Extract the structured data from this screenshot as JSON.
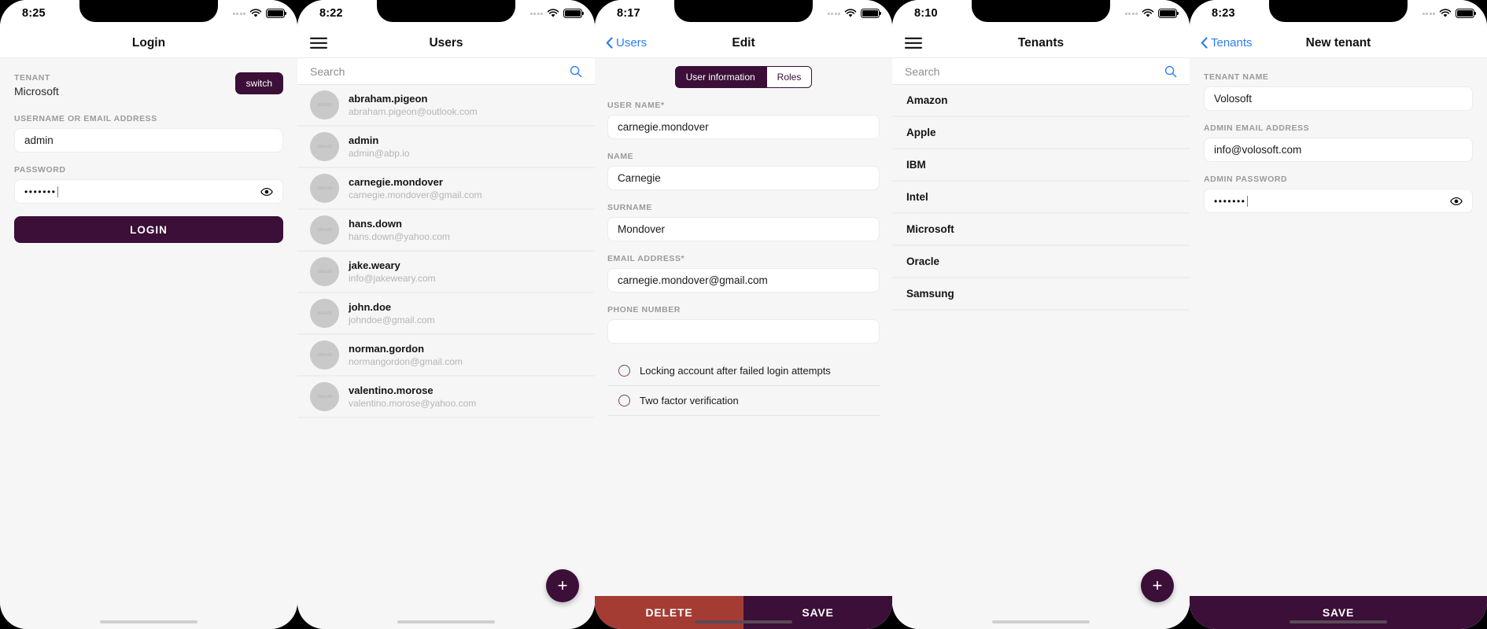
{
  "theme": {
    "primary": "#3b0f38",
    "danger": "#a53c34",
    "link": "#2d7ef7",
    "screen_bg": "#f6f6f6"
  },
  "screens": [
    {
      "id": "login",
      "status": {
        "time": "8:25"
      },
      "nav": {
        "title": "Login"
      },
      "tenant": {
        "label": "TENANT",
        "value": "Microsoft",
        "switch_label": "switch"
      },
      "username": {
        "label": "USERNAME OR EMAIL ADDRESS",
        "value": "admin"
      },
      "password": {
        "label": "PASSWORD",
        "value": "•••••••"
      },
      "login_button": "LOGIN"
    },
    {
      "id": "users",
      "status": {
        "time": "8:22"
      },
      "nav": {
        "title": "Users"
      },
      "search": {
        "placeholder": "Search",
        "value": ""
      },
      "avatar_placeholder": "100x100",
      "users": [
        {
          "name": "abraham.pigeon",
          "email": "abraham.pigeon@outlook.com"
        },
        {
          "name": "admin",
          "email": "admin@abp.io"
        },
        {
          "name": "carnegie.mondover",
          "email": "carnegie.mondover@gmail.com"
        },
        {
          "name": "hans.down",
          "email": "hans.down@yahoo.com"
        },
        {
          "name": "jake.weary",
          "email": "info@jakeweary.com"
        },
        {
          "name": "john.doe",
          "email": "johndoe@gmail.com"
        },
        {
          "name": "norman.gordon",
          "email": "normangordon@gmail.com"
        },
        {
          "name": "valentino.morose",
          "email": "valentino.morose@yahoo.com"
        }
      ],
      "fab_label": "+"
    },
    {
      "id": "edit",
      "status": {
        "time": "8:17"
      },
      "nav": {
        "back": "Users",
        "title": "Edit"
      },
      "tabs": [
        {
          "label": "User information",
          "active": true
        },
        {
          "label": "Roles",
          "active": false
        }
      ],
      "fields": [
        {
          "label": "USER NAME*",
          "value": "carnegie.mondover"
        },
        {
          "label": "NAME",
          "value": "Carnegie"
        },
        {
          "label": "SURNAME",
          "value": "Mondover"
        },
        {
          "label": "EMAIL ADDRESS*",
          "value": "carnegie.mondover@gmail.com"
        },
        {
          "label": "PHONE NUMBER",
          "value": ""
        }
      ],
      "checks": [
        {
          "label": "Locking account after failed login attempts",
          "checked": false
        },
        {
          "label": "Two factor verification",
          "checked": false
        }
      ],
      "actions": {
        "delete": "DELETE",
        "save": "SAVE"
      }
    },
    {
      "id": "tenants",
      "status": {
        "time": "8:10"
      },
      "nav": {
        "title": "Tenants"
      },
      "search": {
        "placeholder": "Search",
        "value": ""
      },
      "tenants": [
        "Amazon",
        "Apple",
        "IBM",
        "Intel",
        "Microsoft",
        "Oracle",
        "Samsung"
      ],
      "fab_label": "+"
    },
    {
      "id": "new-tenant",
      "status": {
        "time": "8:23"
      },
      "nav": {
        "back": "Tenants",
        "title": "New tenant"
      },
      "fields": [
        {
          "label": "TENANT NAME",
          "value": "Volosoft"
        },
        {
          "label": "ADMIN EMAIL ADDRESS",
          "value": "info@volosoft.com"
        }
      ],
      "password": {
        "label": "ADMIN PASSWORD",
        "value": "•••••••"
      },
      "actions": {
        "save": "SAVE"
      }
    }
  ]
}
